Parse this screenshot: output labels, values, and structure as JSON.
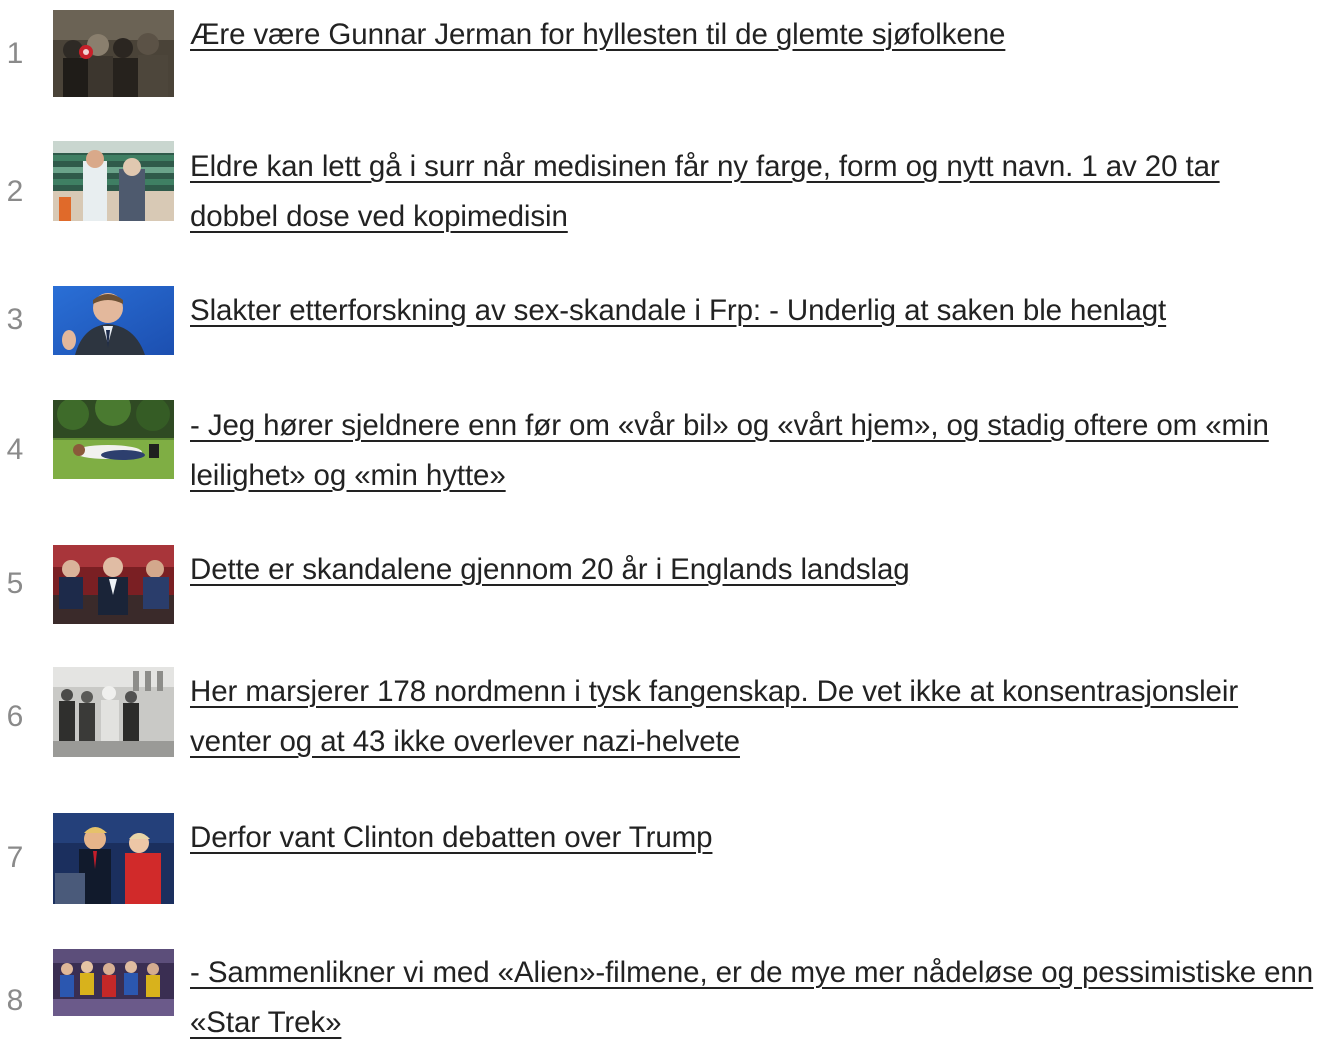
{
  "articles": [
    {
      "rank": "1",
      "title": "Ære være Gunnar Jerman for hyllesten til de glemte sjøfolkene"
    },
    {
      "rank": "2",
      "title": "Eldre kan lett gå i surr når medisinen får ny farge, form og nytt navn. 1 av 20 tar dobbel dose ved kopimedisin"
    },
    {
      "rank": "3",
      "title": "Slakter etterforskning av sex-skandale i Frp: - Underlig at saken ble henlagt"
    },
    {
      "rank": "4",
      "title": "- Jeg hører sjeldnere enn før om «vår bil» og «vårt hjem», og stadig oftere om «min leilighet» og «min hytte»"
    },
    {
      "rank": "5",
      "title": "Dette er skandalene gjennom 20 år i Englands landslag"
    },
    {
      "rank": "6",
      "title": "Her marsjerer 178 nordmenn i tysk fangenskap. De vet ikke at konsentrasjonsleir venter og at 43 ikke overlever nazi-helvete"
    },
    {
      "rank": "7",
      "title": "Derfor vant Clinton debatten over Trump"
    },
    {
      "rank": "8",
      "title": "- Sammenlikner vi med «Alien»-filmene, er de mye mer nådeløse og pessimistiske enn «Star Trek»"
    }
  ]
}
